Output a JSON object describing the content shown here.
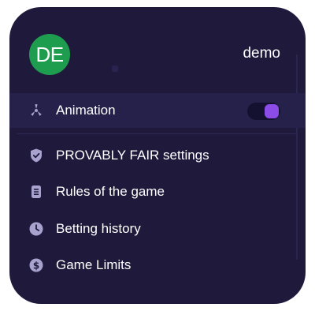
{
  "header": {
    "avatar_initials": "DE",
    "username": "demo"
  },
  "menu": {
    "animation": {
      "label": "Animation",
      "icon": "fan-icon",
      "toggle_on": true
    },
    "items": [
      {
        "label": "PROVABLY FAIR settings",
        "icon": "shield-icon"
      },
      {
        "label": "Rules of the game",
        "icon": "document-icon"
      },
      {
        "label": "Betting history",
        "icon": "clock-icon"
      },
      {
        "label": "Game Limits",
        "icon": "dollar-icon"
      }
    ]
  },
  "colors": {
    "panel_bg": "#1f1a3c",
    "avatar_bg": "#1e9d4f",
    "toggle_accent": "#8b4ce8",
    "icon_color": "#a8a2cf"
  }
}
